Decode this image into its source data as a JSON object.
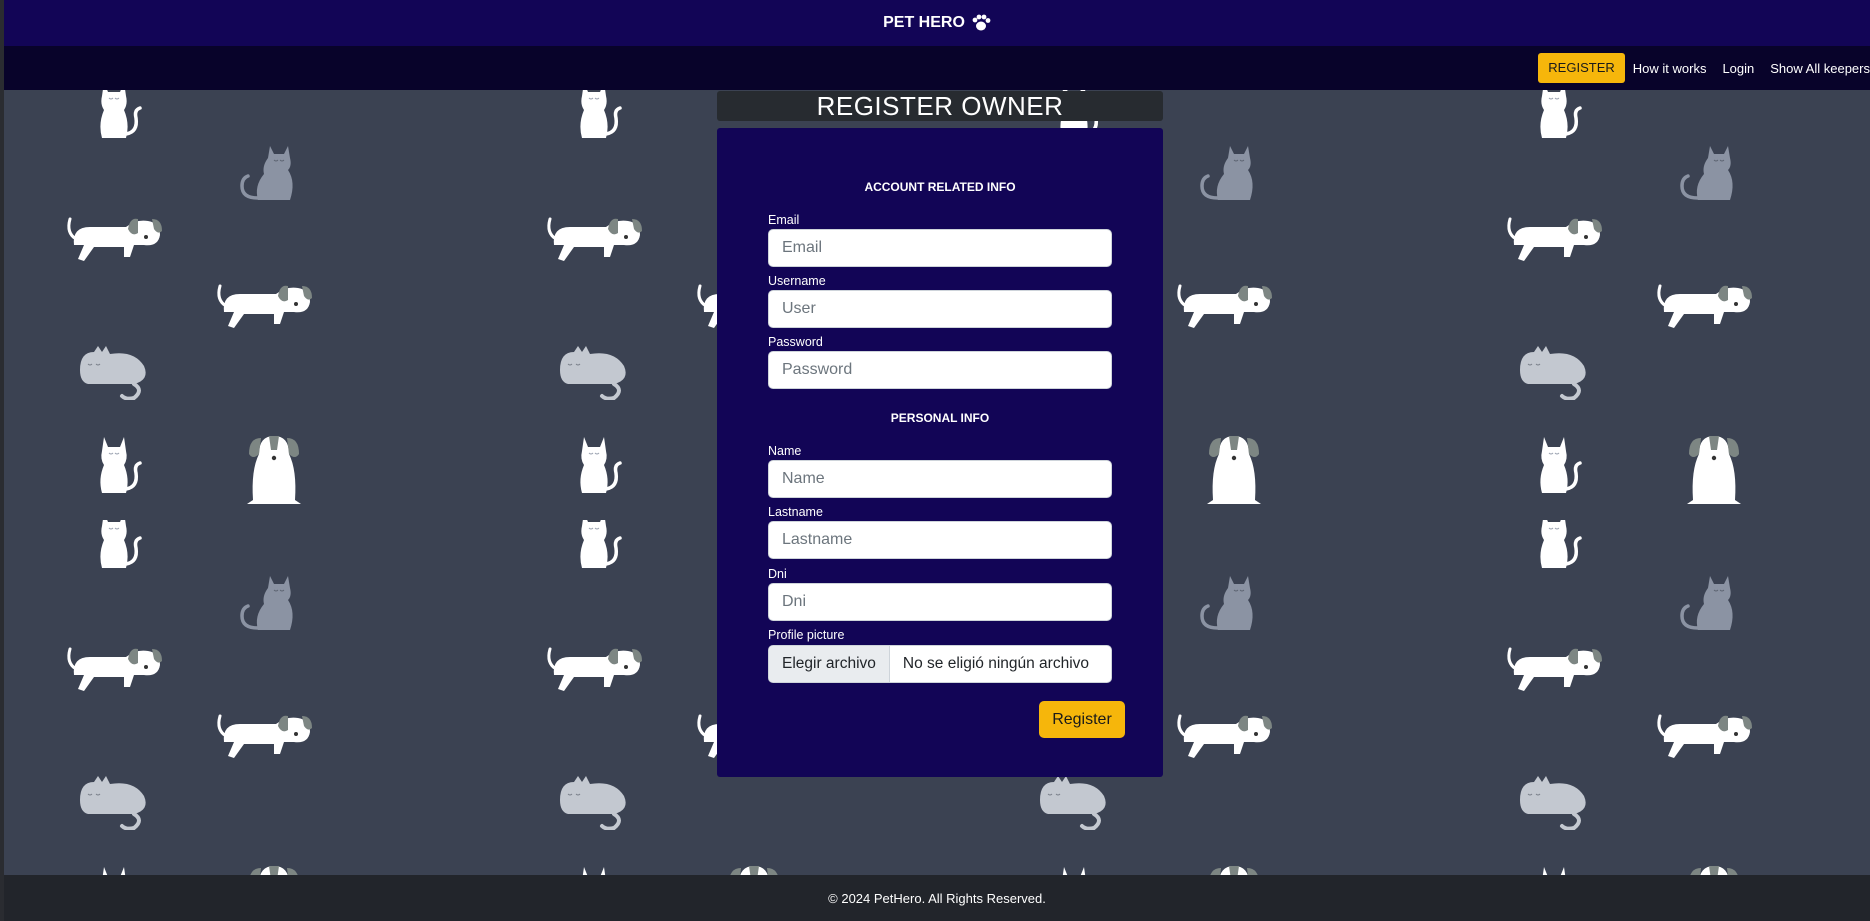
{
  "brand": {
    "title": "PET HERO",
    "icon": "paw-icon"
  },
  "nav": {
    "register": "REGISTER",
    "how_it_works": "How it works",
    "login": "Login",
    "show_keepers": "Show All keepers"
  },
  "page": {
    "title": "REGISTER OWNER"
  },
  "form": {
    "account_heading": "ACCOUNT RELATED INFO",
    "personal_heading": "PERSONAL INFO",
    "email": {
      "label": "Email",
      "placeholder": "Email",
      "value": ""
    },
    "username": {
      "label": "Username",
      "placeholder": "User",
      "value": ""
    },
    "password": {
      "label": "Password",
      "placeholder": "Password",
      "value": ""
    },
    "name": {
      "label": "Name",
      "placeholder": "Name",
      "value": ""
    },
    "lastname": {
      "label": "Lastname",
      "placeholder": "Lastname",
      "value": ""
    },
    "dni": {
      "label": "Dni",
      "placeholder": "Dni",
      "value": ""
    },
    "profile_picture": {
      "label": "Profile picture",
      "button": "Elegir archivo",
      "status": "No se eligió ningún archivo"
    },
    "submit": "Register"
  },
  "footer": {
    "text": "© 2024 PetHero. All Rights Reserved."
  },
  "colors": {
    "brand_bar": "#120556",
    "nav_bar": "#08032a",
    "accent": "#f6b60b",
    "background": "#3b4252",
    "footer": "#22252b",
    "card": "#120556"
  },
  "background_pattern": {
    "icons": [
      "white-cat-icon",
      "gray-cat-icon",
      "white-dog-icon",
      "sitting-dog-icon",
      "sleeping-cat-icon"
    ]
  }
}
